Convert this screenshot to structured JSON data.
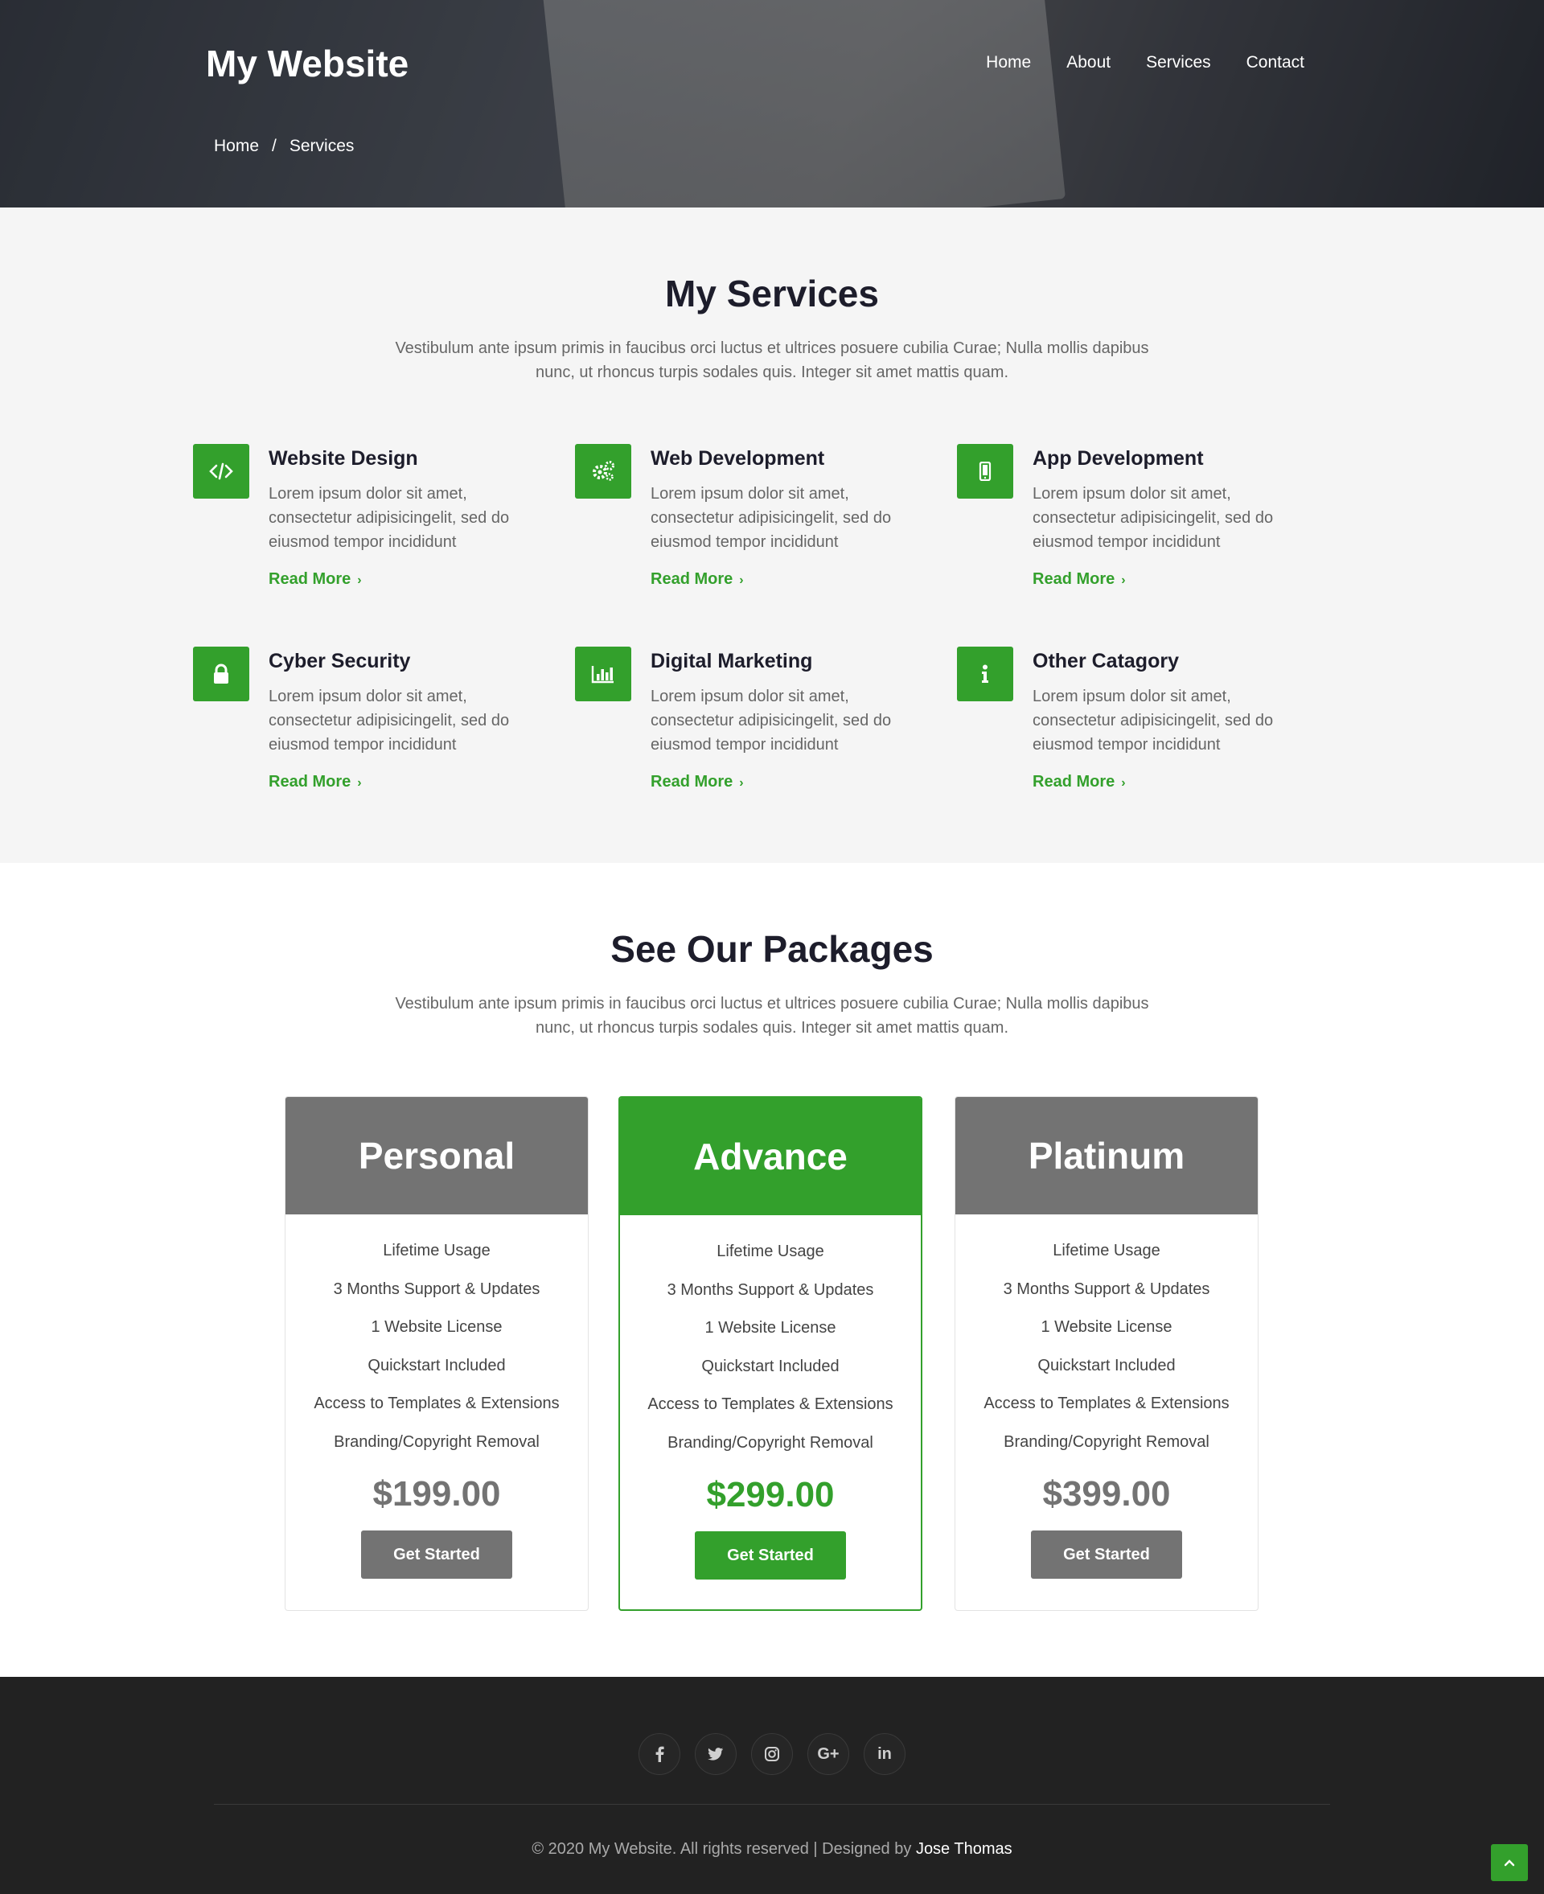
{
  "brand": "My Website",
  "nav": [
    "Home",
    "About",
    "Services",
    "Contact"
  ],
  "breadcrumb": {
    "home": "Home",
    "sep": "/",
    "current": "Services"
  },
  "services": {
    "title": "My Services",
    "subtitle": "Vestibulum ante ipsum primis in faucibus orci luctus et ultrices posuere cubilia Curae; Nulla mollis dapibus nunc, ut rhoncus turpis sodales quis. Integer sit amet mattis quam.",
    "items": [
      {
        "icon": "code-icon",
        "title": "Website Design",
        "text": "Lorem ipsum dolor sit amet, consectetur adipisicingelit, sed do eiusmod tempor incididunt",
        "link": "Read More"
      },
      {
        "icon": "gears-icon",
        "title": "Web Development",
        "text": "Lorem ipsum dolor sit amet, consectetur adipisicingelit, sed do eiusmod tempor incididunt",
        "link": "Read More"
      },
      {
        "icon": "mobile-icon",
        "title": "App Development",
        "text": "Lorem ipsum dolor sit amet, consectetur adipisicingelit, sed do eiusmod tempor incididunt",
        "link": "Read More"
      },
      {
        "icon": "lock-icon",
        "title": "Cyber Security",
        "text": "Lorem ipsum dolor sit amet, consectetur adipisicingelit, sed do eiusmod tempor incididunt",
        "link": "Read More"
      },
      {
        "icon": "bar-chart-icon",
        "title": "Digital Marketing",
        "text": "Lorem ipsum dolor sit amet, consectetur adipisicingelit, sed do eiusmod tempor incididunt",
        "link": "Read More"
      },
      {
        "icon": "info-icon",
        "title": "Other Catagory",
        "text": "Lorem ipsum dolor sit amet, consectetur adipisicingelit, sed do eiusmod tempor incididunt",
        "link": "Read More"
      }
    ]
  },
  "packages": {
    "title": "See Our Packages",
    "subtitle": "Vestibulum ante ipsum primis in faucibus orci luctus et ultrices posuere cubilia Curae; Nulla mollis dapibus nunc, ut rhoncus turpis sodales quis. Integer sit amet mattis quam.",
    "features": [
      "Lifetime Usage",
      "3 Months Support & Updates",
      "1 Website License",
      "Quickstart Included",
      "Access to Templates & Extensions",
      "Branding/Copyright Removal"
    ],
    "plans": [
      {
        "name": "Personal",
        "price": "$199.00",
        "button": "Get Started",
        "highlight": false
      },
      {
        "name": "Advance",
        "price": "$299.00",
        "button": "Get Started",
        "highlight": true
      },
      {
        "name": "Platinum",
        "price": "$399.00",
        "button": "Get Started",
        "highlight": false
      }
    ]
  },
  "footer": {
    "socials": [
      "facebook-icon",
      "twitter-icon",
      "instagram-icon",
      "google-plus-icon",
      "linkedin-icon"
    ],
    "copyright": "© 2020 My Website. All rights reserved | Designed by",
    "author": "Jose Thomas"
  },
  "colors": {
    "accent": "#33a02c",
    "gray": "#737373",
    "footer": "#222222"
  }
}
